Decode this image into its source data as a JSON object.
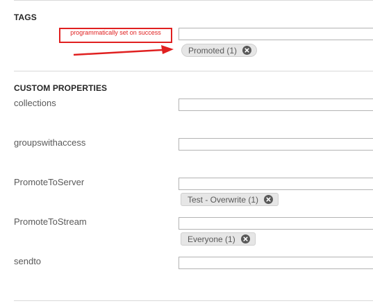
{
  "tags": {
    "title": "TAGS",
    "input_value": "",
    "chips": [
      {
        "label": "Promoted (1)",
        "icon": "close-circle-icon"
      }
    ],
    "annotation": {
      "text": "programmatically set on success",
      "color": "#e02020"
    }
  },
  "custom_properties": {
    "title": "CUSTOM PROPERTIES",
    "items": [
      {
        "label": "collections",
        "input_value": "",
        "chips": []
      },
      {
        "label": "groupswithaccess",
        "input_value": "",
        "chips": []
      },
      {
        "label": "PromoteToServer",
        "input_value": "",
        "chips": [
          {
            "label": "Test - Overwrite (1)",
            "icon": "close-circle-icon"
          }
        ]
      },
      {
        "label": "PromoteToStream",
        "input_value": "",
        "chips": [
          {
            "label": "Everyone (1)",
            "icon": "close-circle-icon"
          }
        ]
      },
      {
        "label": "sendto",
        "input_value": "",
        "chips": []
      }
    ]
  },
  "colors": {
    "chip_bg": "#e6e6e6",
    "border": "#b3b3b3",
    "annotation_red": "#e02020"
  }
}
